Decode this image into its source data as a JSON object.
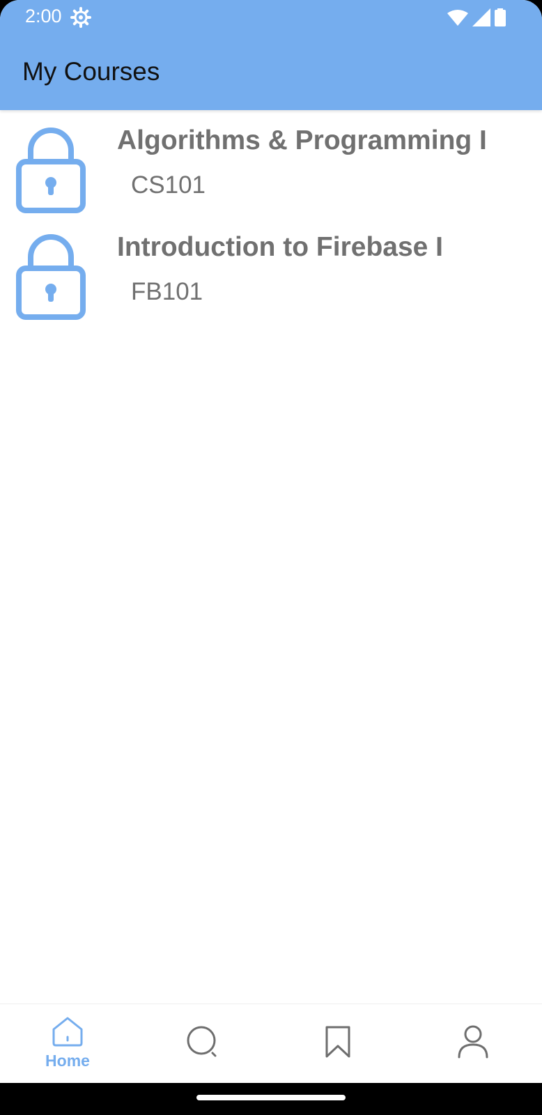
{
  "status_bar": {
    "time": "2:00",
    "icons": [
      "gear-icon",
      "wifi-icon",
      "signal-icon",
      "battery-icon"
    ]
  },
  "app_bar": {
    "title": "My Courses",
    "background": "#75adee"
  },
  "courses": [
    {
      "title": "Algorithms & Programming I",
      "code": "CS101",
      "icon": "lock-icon"
    },
    {
      "title": "Introduction to Firebase I",
      "code": "FB101",
      "icon": "lock-icon"
    }
  ],
  "bottom_nav": {
    "items": [
      {
        "label": "Home",
        "icon": "home-icon",
        "active": true
      },
      {
        "label": "",
        "icon": "search-icon",
        "active": false
      },
      {
        "label": "",
        "icon": "bookmark-icon",
        "active": false
      },
      {
        "label": "",
        "icon": "profile-icon",
        "active": false
      }
    ],
    "active_color": "#75adee",
    "inactive_color": "#6e6e6e"
  },
  "colors": {
    "accent": "#75adee",
    "text_secondary": "#707070"
  }
}
